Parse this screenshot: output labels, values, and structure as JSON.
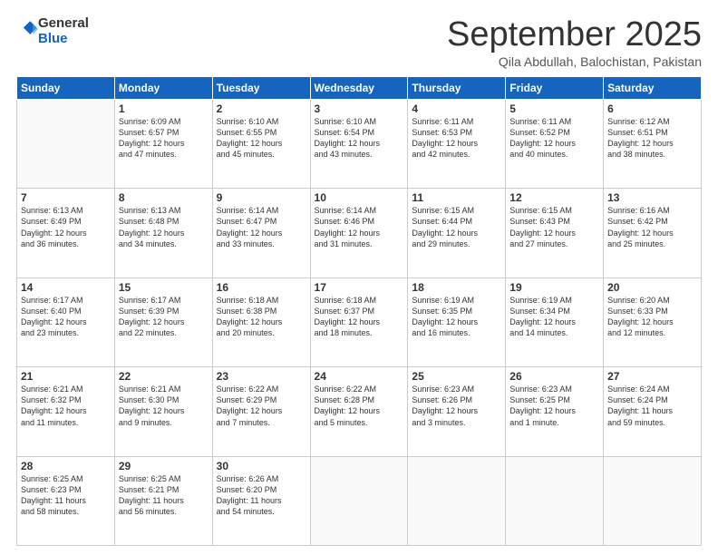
{
  "header": {
    "logo_general": "General",
    "logo_blue": "Blue",
    "month": "September 2025",
    "location": "Qila Abdullah, Balochistan, Pakistan"
  },
  "weekdays": [
    "Sunday",
    "Monday",
    "Tuesday",
    "Wednesday",
    "Thursday",
    "Friday",
    "Saturday"
  ],
  "weeks": [
    [
      {
        "day": "",
        "info": ""
      },
      {
        "day": "1",
        "info": "Sunrise: 6:09 AM\nSunset: 6:57 PM\nDaylight: 12 hours\nand 47 minutes."
      },
      {
        "day": "2",
        "info": "Sunrise: 6:10 AM\nSunset: 6:55 PM\nDaylight: 12 hours\nand 45 minutes."
      },
      {
        "day": "3",
        "info": "Sunrise: 6:10 AM\nSunset: 6:54 PM\nDaylight: 12 hours\nand 43 minutes."
      },
      {
        "day": "4",
        "info": "Sunrise: 6:11 AM\nSunset: 6:53 PM\nDaylight: 12 hours\nand 42 minutes."
      },
      {
        "day": "5",
        "info": "Sunrise: 6:11 AM\nSunset: 6:52 PM\nDaylight: 12 hours\nand 40 minutes."
      },
      {
        "day": "6",
        "info": "Sunrise: 6:12 AM\nSunset: 6:51 PM\nDaylight: 12 hours\nand 38 minutes."
      }
    ],
    [
      {
        "day": "7",
        "info": "Sunrise: 6:13 AM\nSunset: 6:49 PM\nDaylight: 12 hours\nand 36 minutes."
      },
      {
        "day": "8",
        "info": "Sunrise: 6:13 AM\nSunset: 6:48 PM\nDaylight: 12 hours\nand 34 minutes."
      },
      {
        "day": "9",
        "info": "Sunrise: 6:14 AM\nSunset: 6:47 PM\nDaylight: 12 hours\nand 33 minutes."
      },
      {
        "day": "10",
        "info": "Sunrise: 6:14 AM\nSunset: 6:46 PM\nDaylight: 12 hours\nand 31 minutes."
      },
      {
        "day": "11",
        "info": "Sunrise: 6:15 AM\nSunset: 6:44 PM\nDaylight: 12 hours\nand 29 minutes."
      },
      {
        "day": "12",
        "info": "Sunrise: 6:15 AM\nSunset: 6:43 PM\nDaylight: 12 hours\nand 27 minutes."
      },
      {
        "day": "13",
        "info": "Sunrise: 6:16 AM\nSunset: 6:42 PM\nDaylight: 12 hours\nand 25 minutes."
      }
    ],
    [
      {
        "day": "14",
        "info": "Sunrise: 6:17 AM\nSunset: 6:40 PM\nDaylight: 12 hours\nand 23 minutes."
      },
      {
        "day": "15",
        "info": "Sunrise: 6:17 AM\nSunset: 6:39 PM\nDaylight: 12 hours\nand 22 minutes."
      },
      {
        "day": "16",
        "info": "Sunrise: 6:18 AM\nSunset: 6:38 PM\nDaylight: 12 hours\nand 20 minutes."
      },
      {
        "day": "17",
        "info": "Sunrise: 6:18 AM\nSunset: 6:37 PM\nDaylight: 12 hours\nand 18 minutes."
      },
      {
        "day": "18",
        "info": "Sunrise: 6:19 AM\nSunset: 6:35 PM\nDaylight: 12 hours\nand 16 minutes."
      },
      {
        "day": "19",
        "info": "Sunrise: 6:19 AM\nSunset: 6:34 PM\nDaylight: 12 hours\nand 14 minutes."
      },
      {
        "day": "20",
        "info": "Sunrise: 6:20 AM\nSunset: 6:33 PM\nDaylight: 12 hours\nand 12 minutes."
      }
    ],
    [
      {
        "day": "21",
        "info": "Sunrise: 6:21 AM\nSunset: 6:32 PM\nDaylight: 12 hours\nand 11 minutes."
      },
      {
        "day": "22",
        "info": "Sunrise: 6:21 AM\nSunset: 6:30 PM\nDaylight: 12 hours\nand 9 minutes."
      },
      {
        "day": "23",
        "info": "Sunrise: 6:22 AM\nSunset: 6:29 PM\nDaylight: 12 hours\nand 7 minutes."
      },
      {
        "day": "24",
        "info": "Sunrise: 6:22 AM\nSunset: 6:28 PM\nDaylight: 12 hours\nand 5 minutes."
      },
      {
        "day": "25",
        "info": "Sunrise: 6:23 AM\nSunset: 6:26 PM\nDaylight: 12 hours\nand 3 minutes."
      },
      {
        "day": "26",
        "info": "Sunrise: 6:23 AM\nSunset: 6:25 PM\nDaylight: 12 hours\nand 1 minute."
      },
      {
        "day": "27",
        "info": "Sunrise: 6:24 AM\nSunset: 6:24 PM\nDaylight: 11 hours\nand 59 minutes."
      }
    ],
    [
      {
        "day": "28",
        "info": "Sunrise: 6:25 AM\nSunset: 6:23 PM\nDaylight: 11 hours\nand 58 minutes."
      },
      {
        "day": "29",
        "info": "Sunrise: 6:25 AM\nSunset: 6:21 PM\nDaylight: 11 hours\nand 56 minutes."
      },
      {
        "day": "30",
        "info": "Sunrise: 6:26 AM\nSunset: 6:20 PM\nDaylight: 11 hours\nand 54 minutes."
      },
      {
        "day": "",
        "info": ""
      },
      {
        "day": "",
        "info": ""
      },
      {
        "day": "",
        "info": ""
      },
      {
        "day": "",
        "info": ""
      }
    ]
  ]
}
